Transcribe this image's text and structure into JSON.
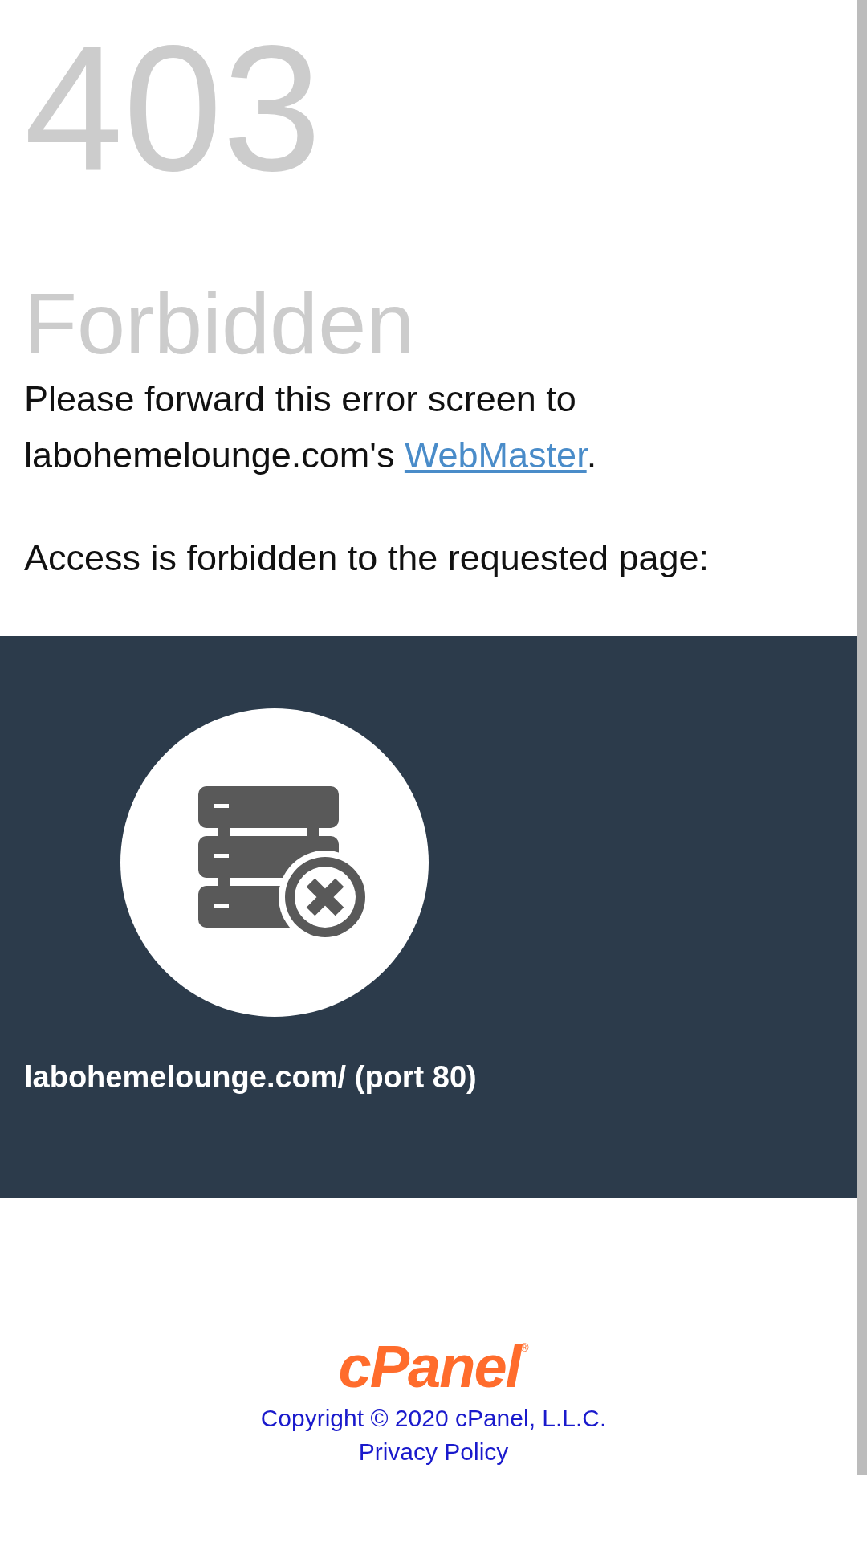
{
  "error_code": "403",
  "error_title": "Forbidden",
  "message": {
    "before_link": "Please forward this error screen to labohemelounge.com's ",
    "link": "WebMaster",
    "after_link": "."
  },
  "access_text": "Access is forbidden to the requested page:",
  "panel": {
    "host": "labohemelounge.com/ (port 80)"
  },
  "footer": {
    "logo": "cPanel",
    "registered_mark": "®",
    "copyright": "Copyright © 2020 cPanel, L.L.C.",
    "privacy_link": "Privacy Policy"
  }
}
